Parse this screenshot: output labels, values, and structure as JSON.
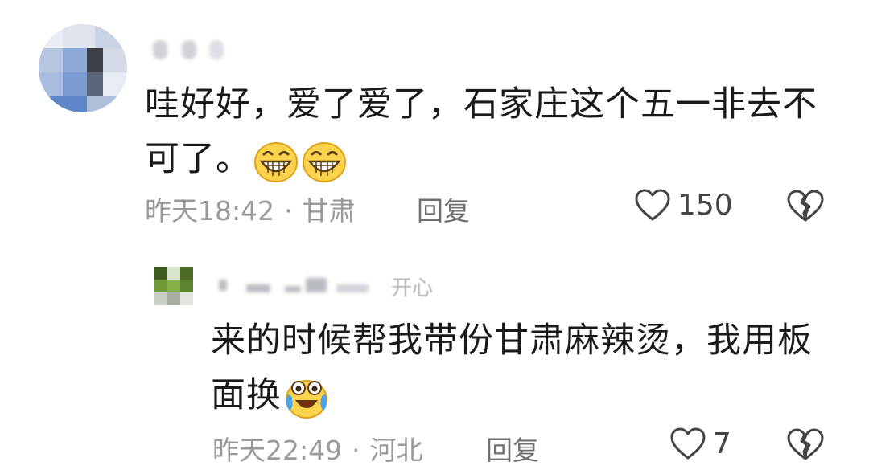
{
  "comments": [
    {
      "text": "哇好好，爱了爱了，石家庄这个五一非去不可了。",
      "time": "昨天18:42",
      "dot": "·",
      "location": "甘肃",
      "reply_label": "回复",
      "likes": "150",
      "emoji": [
        "grinning-face-icon",
        "grinning-face-icon"
      ]
    }
  ],
  "replies": [
    {
      "username_visible_fragment": "开心",
      "text": "来的时候帮我带份甘肃麻辣烫，我用板面换",
      "time": "昨天22:49",
      "dot": "·",
      "location": "河北",
      "reply_label": "回复",
      "likes": "7",
      "emoji": [
        "tears-of-joy-face-icon"
      ]
    }
  ],
  "colors": {
    "text": "#1a1a1a",
    "meta": "#9a9a9a",
    "icon_stroke": "#444444",
    "emoji_yellow": "#fcd34d"
  }
}
